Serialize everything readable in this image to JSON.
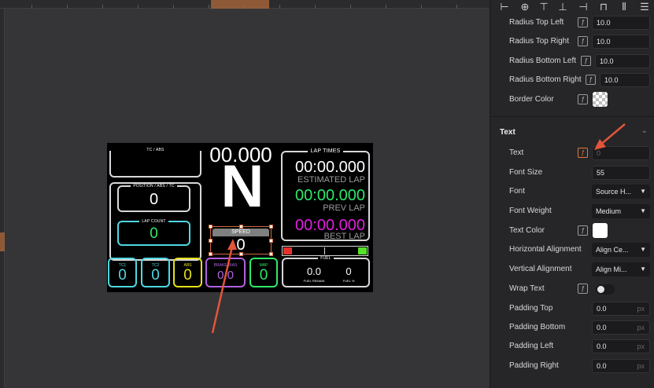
{
  "dashboard": {
    "tc_abs_label": "TC / ABS",
    "speed_top": "00.000",
    "gear": "N",
    "lap_times_label": "LAP TIMES",
    "estimated_time": "00:00.000",
    "estimated_label": "ESTIMATED LAP",
    "prev_time": "00:00.000",
    "prev_label": "PREV LAP",
    "best_time": "00:00.000",
    "best_label": "BEST LAP",
    "position_label": "POSITION / ABS / TC",
    "position_value": "0",
    "lap_count_label": "LAP COUNT",
    "lap_count_value": "0",
    "speed_label": "SPEED",
    "speed_value": "0",
    "tc1_label": "TC1",
    "tc1_value": "0",
    "tc2_label": "TC2",
    "tc2_value": "0",
    "abs_label": "ABS",
    "abs_value": "0",
    "brake_bias_label": "BRAKE BIAS",
    "brake_bias_value": "0.0",
    "map_label": "MAP",
    "map_value": "0",
    "fuel_label": "FUEL",
    "fuel_remain_value": "0.0",
    "fuel_remain_label": "FUEL REMAIN",
    "fuel_pct_value": "0",
    "fuel_pct_label": "FUEL %",
    "colors": {
      "white": "#d8d8d8",
      "green": "#2ee86a",
      "magenta": "#e21fe0",
      "cyan": "#4fd8e0",
      "yellow": "#e6e01a",
      "purple": "#b062e0",
      "red": "#e8302a",
      "lime": "#55e02a"
    }
  },
  "panel": {
    "radius_top_left_label": "Radius Top Left",
    "radius_top_left_value": "10.0",
    "radius_top_right_label": "Radius Top Right",
    "radius_top_right_value": "10.0",
    "radius_bottom_left_label": "Radius Bottom Left",
    "radius_bottom_left_value": "10.0",
    "radius_bottom_right_label": "Radius Bottom Right",
    "radius_bottom_right_value": "10.0",
    "border_color_label": "Border Color",
    "section_title": "Text",
    "text_label": "Text",
    "text_value": "0",
    "font_size_label": "Font Size",
    "font_size_value": "55",
    "font_label": "Font",
    "font_value": "Source H...",
    "font_weight_label": "Font Weight",
    "font_weight_value": "Medium",
    "text_color_label": "Text Color",
    "h_align_label": "Horizontal Alignment",
    "h_align_value": "Align Ce...",
    "v_align_label": "Vertical Alignment",
    "v_align_value": "Align Mi...",
    "wrap_text_label": "Wrap Text",
    "padding_top_label": "Padding Top",
    "padding_top_value": "0.0",
    "padding_bottom_label": "Padding Bottom",
    "padding_bottom_value": "0.0",
    "padding_left_label": "Padding Left",
    "padding_left_value": "0.0",
    "padding_right_label": "Padding Right",
    "padding_right_value": "0.0",
    "unit_px": "px",
    "accent_color": "#e07a3c"
  }
}
